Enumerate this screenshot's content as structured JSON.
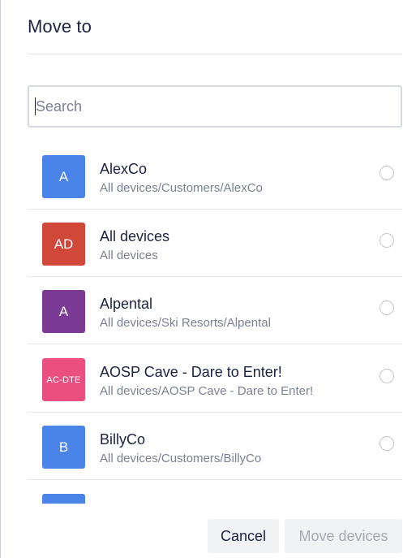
{
  "dialog": {
    "title": "Move to"
  },
  "search": {
    "placeholder": "Search",
    "value": ""
  },
  "items": [
    {
      "initials": "A",
      "name": "AlexCo",
      "path": "All devices/Customers/AlexCo",
      "color": "#4a84e8"
    },
    {
      "initials": "AD",
      "name": "All devices",
      "path": "All devices",
      "color": "#d1473a"
    },
    {
      "initials": "A",
      "name": "Alpental",
      "path": "All devices/Ski Resorts/Alpental",
      "color": "#7a3a96"
    },
    {
      "initials": "AC-DTE",
      "name": "AOSP Cave - Dare to Enter!",
      "path": "All devices/AOSP Cave - Dare to Enter!",
      "color": "#eb4f80"
    },
    {
      "initials": "B",
      "name": "BillyCo",
      "path": "All devices/Customers/BillyCo",
      "color": "#4a84e8"
    },
    {
      "initials": "",
      "name": "",
      "path": "",
      "color": "#4a84e8"
    }
  ],
  "footer": {
    "cancel_label": "Cancel",
    "move_label": "Move devices"
  }
}
